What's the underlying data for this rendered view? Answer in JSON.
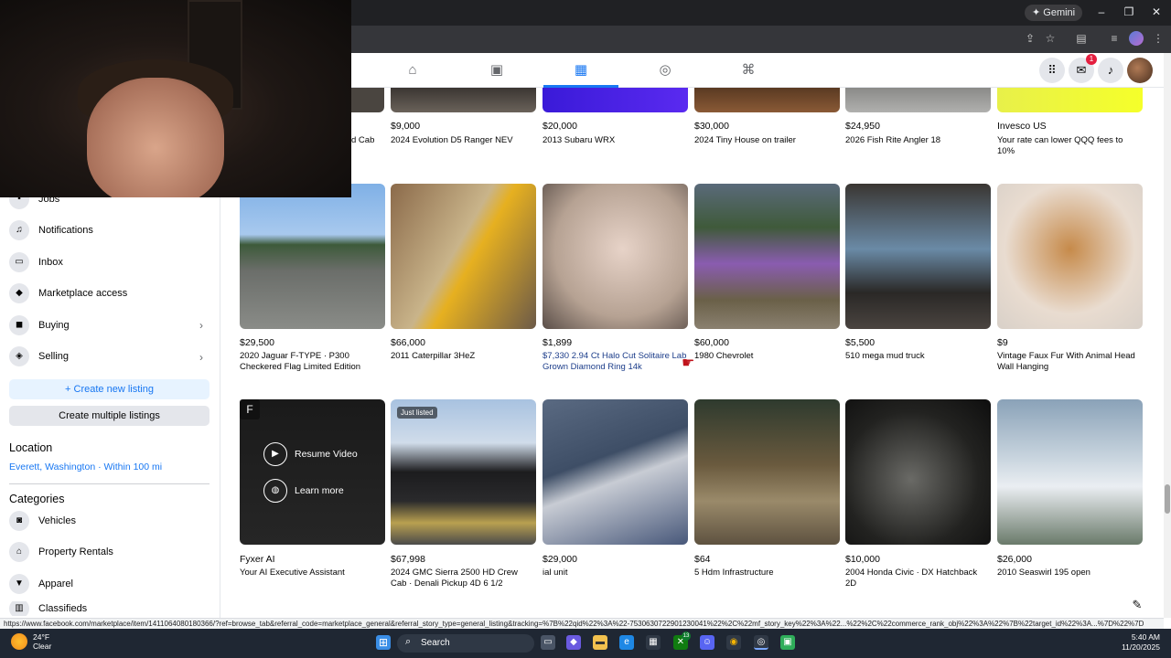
{
  "browser": {
    "gemini_label": "Gemini",
    "status_url": "https://www.facebook.com/marketplace/item/1411064080180366/?ref=browse_tab&referral_code=marketplace_general&referral_story_type=general_listing&tracking=%7B%22qid%22%3A%22-7530630722901230041%22%2C%22mf_story_key%22%3A%22...%22%2C%22commerce_rank_obj%22%3A%22%7B%22target_id%22%3A...%7D%22%7D"
  },
  "fb_nav": {
    "notification_count": "1"
  },
  "sidebar": {
    "items": [
      {
        "label": "Jobs",
        "icon": "briefcase-icon"
      },
      {
        "label": "Notifications",
        "icon": "bell-icon"
      },
      {
        "label": "Inbox",
        "icon": "inbox-icon"
      },
      {
        "label": "Marketplace access",
        "icon": "shield-icon"
      },
      {
        "label": "Buying",
        "icon": "bag-icon"
      },
      {
        "label": "Selling",
        "icon": "tag-icon"
      }
    ],
    "create_listing": "+ Create new listing",
    "create_multiple": "Create multiple listings",
    "location_heading": "Location",
    "location_value": "Everett, Washington · Within 100 mi",
    "categories_heading": "Categories",
    "categories": [
      {
        "label": "Vehicles",
        "icon": "car-icon"
      },
      {
        "label": "Property Rentals",
        "icon": "house-icon"
      },
      {
        "label": "Apparel",
        "icon": "shirt-icon"
      },
      {
        "label": "Classifieds",
        "icon": "classifieds-icon"
      }
    ]
  },
  "listings_row1": [
    {
      "price": "",
      "title": "d Cab"
    },
    {
      "price": "$9,000",
      "title": "2024 Evolution D5 Ranger NEV"
    },
    {
      "price": "$20,000",
      "title": "2013 Subaru WRX"
    },
    {
      "price": "$30,000",
      "title": "2024 Tiny House on trailer"
    },
    {
      "price": "$24,950",
      "title": "2026 Fish Rite Angler 18"
    },
    {
      "price": "Invesco US",
      "title": "Your rate can lower QQQ fees to 10%"
    }
  ],
  "listings_row2": [
    {
      "price": "$29,500",
      "title": "2020 Jaguar F-TYPE · P300 Checkered Flag Limited Edition"
    },
    {
      "price": "$66,000",
      "title": "2011 Caterpillar 3HeZ"
    },
    {
      "price": "$1,899",
      "title": "$7,330 2.94 Ct Halo Cut Solitaire Lab Grown Diamond Ring 14k"
    },
    {
      "price": "$60,000",
      "title": "1980 Chevrolet"
    },
    {
      "price": "$5,500",
      "title": "510 mega mud truck"
    },
    {
      "price": "$9",
      "title": "Vintage Faux Fur With Animal Head Wall Hanging"
    }
  ],
  "listings_row3": [
    {
      "price": "Fyxer AI",
      "title": "Your AI Executive Assistant"
    },
    {
      "price": "$67,998",
      "title": "2024 GMC Sierra 2500 HD Crew Cab · Denali Pickup 4D 6 1/2"
    },
    {
      "price": "$29,000",
      "title": "ial unit"
    },
    {
      "price": "$64",
      "title": "5 Hdm Infrastructure"
    },
    {
      "price": "$10,000",
      "title": "2004 Honda Civic · DX Hatchback 2D"
    },
    {
      "price": "$26,000",
      "title": "2010 Seaswirl 195 open"
    }
  ],
  "ad": {
    "resume_video": "Resume Video",
    "learn_more": "Learn more",
    "logo_letter": "F"
  },
  "just_listed_tag": "Just listed",
  "taskbar": {
    "temperature": "24°F",
    "condition": "Clear",
    "search_label": "Search",
    "time": "5:40 AM",
    "date": "11/20/2025",
    "discord_badge": "13"
  }
}
